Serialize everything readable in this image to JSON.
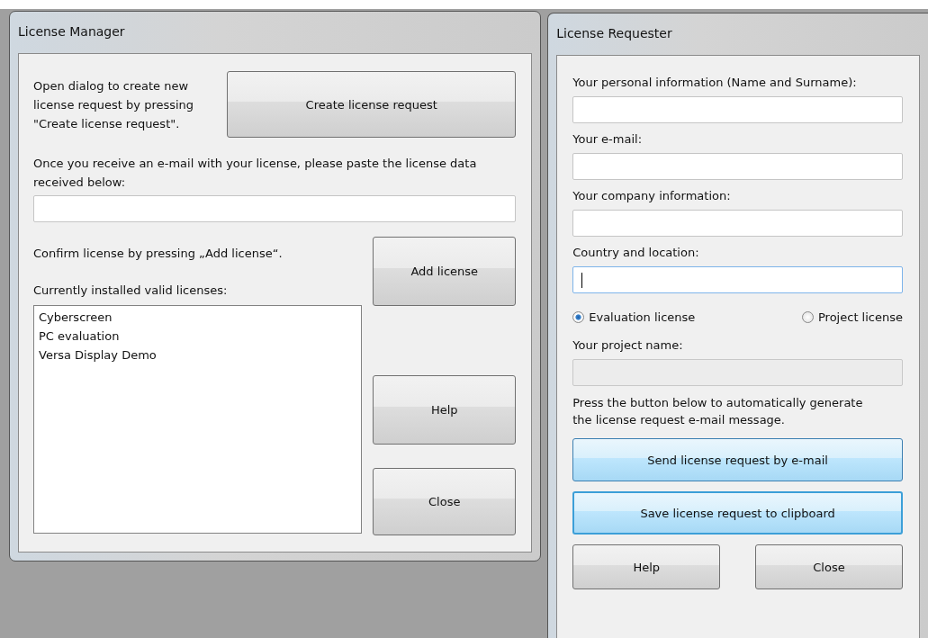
{
  "license_manager": {
    "title": "License Manager",
    "create_text": "Open dialog to create new license request by pressing \"Create license request\".",
    "create_button": "Create license request",
    "paste_text": "Once you receive an e-mail with your license, please paste the license data received below:",
    "confirm_text": "Confirm license by pressing „Add license“.",
    "add_button": "Add license",
    "installed_label": "Currently installed valid licenses:",
    "licenses": [
      "Cyberscreen",
      "PC evaluation",
      "Versa Display Demo"
    ],
    "help_button": "Help",
    "close_button": "Close"
  },
  "license_requester": {
    "title": "License Requester",
    "fields": [
      {
        "label": "Your personal information (Name and Surname):",
        "focused": false
      },
      {
        "label": "Your e-mail:",
        "focused": false
      },
      {
        "label": "Your company information:",
        "focused": false
      },
      {
        "label": "Country and location:",
        "focused": true
      }
    ],
    "license_types": [
      {
        "label": "Evaluation license",
        "selected": true
      },
      {
        "label": "Project license",
        "selected": false
      }
    ],
    "project_name": {
      "label": "Your project name:",
      "disabled": true
    },
    "hint": "Press the button below to automatically generate the license request e-mail message.",
    "actions": [
      {
        "label": "Send license request by e-mail",
        "kind": "hover"
      },
      {
        "label": "Save license request to clipboard",
        "kind": "default"
      }
    ],
    "help_button": "Help",
    "close_button": "Close"
  }
}
